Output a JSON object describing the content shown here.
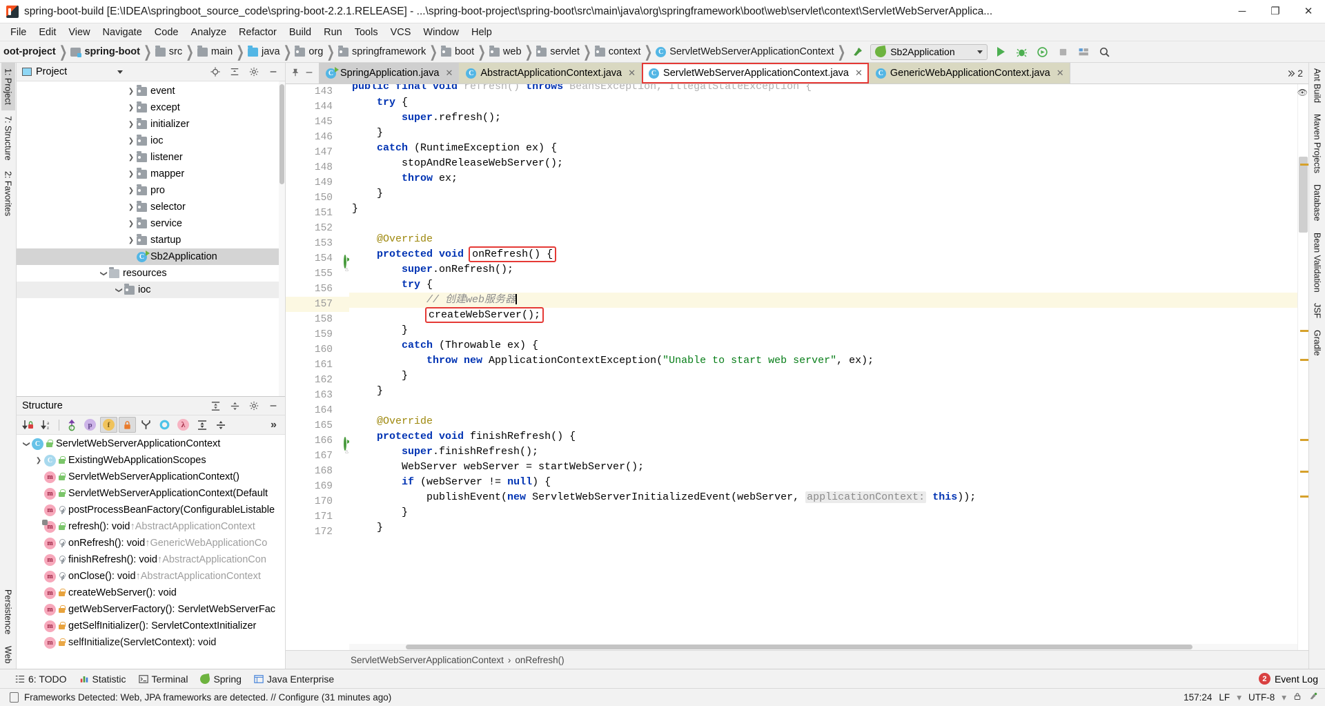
{
  "window": {
    "title": "spring-boot-build [E:\\IDEA\\springboot_source_code\\spring-boot-2.2.1.RELEASE] - ...\\spring-boot-project\\spring-boot\\src\\main\\java\\org\\springframework\\boot\\web\\servlet\\context\\ServletWebServerApplica...",
    "minimize": "─",
    "maximize": "❐",
    "close": "✕"
  },
  "menubar": [
    "File",
    "Edit",
    "View",
    "Navigate",
    "Code",
    "Analyze",
    "Refactor",
    "Build",
    "Run",
    "Tools",
    "VCS",
    "Window",
    "Help"
  ],
  "navbar": {
    "crumbs": [
      {
        "label": "oot-project",
        "icon": "none",
        "bold": true
      },
      {
        "label": "spring-boot",
        "icon": "module",
        "bold": true
      },
      {
        "label": "src",
        "icon": "folder-src",
        "bold": false
      },
      {
        "label": "main",
        "icon": "folder",
        "bold": false
      },
      {
        "label": "java",
        "icon": "folder-blue",
        "bold": false
      },
      {
        "label": "org",
        "icon": "folder-pkg",
        "bold": false
      },
      {
        "label": "springframework",
        "icon": "folder-pkg",
        "bold": false
      },
      {
        "label": "boot",
        "icon": "folder-pkg",
        "bold": false
      },
      {
        "label": "web",
        "icon": "folder-pkg",
        "bold": false
      },
      {
        "label": "servlet",
        "icon": "folder-pkg",
        "bold": false
      },
      {
        "label": "context",
        "icon": "folder-pkg",
        "bold": false
      },
      {
        "label": "ServletWebServerApplicationContext",
        "icon": "class",
        "bold": false
      }
    ],
    "separator": "❯",
    "run_config": "Sb2Application",
    "buttons": [
      "make-project-icon",
      "run-icon",
      "debug-icon",
      "run-with-coverage-icon",
      "stop-icon",
      "search-everywhere-icon",
      "settings-icon"
    ]
  },
  "project_panel": {
    "title": "Project",
    "header_icons": [
      "locate-icon",
      "collapse-all-icon",
      "settings-icon",
      "hide-icon"
    ],
    "items": [
      {
        "label": "event",
        "indent": 5,
        "arrow": "right",
        "icon": "folder-pkg",
        "selected": false
      },
      {
        "label": "except",
        "indent": 5,
        "arrow": "right",
        "icon": "folder-pkg",
        "selected": false
      },
      {
        "label": "initializer",
        "indent": 5,
        "arrow": "right",
        "icon": "folder-pkg",
        "selected": false
      },
      {
        "label": "ioc",
        "indent": 5,
        "arrow": "right",
        "icon": "folder-pkg",
        "selected": false
      },
      {
        "label": "listener",
        "indent": 5,
        "arrow": "right",
        "icon": "folder-pkg",
        "selected": false
      },
      {
        "label": "mapper",
        "indent": 5,
        "arrow": "right",
        "icon": "folder-pkg",
        "selected": false
      },
      {
        "label": "pro",
        "indent": 5,
        "arrow": "right",
        "icon": "folder-pkg",
        "selected": false
      },
      {
        "label": "selector",
        "indent": 5,
        "arrow": "right",
        "icon": "folder-pkg",
        "selected": false
      },
      {
        "label": "service",
        "indent": 5,
        "arrow": "right",
        "icon": "folder-pkg",
        "selected": false
      },
      {
        "label": "startup",
        "indent": 5,
        "arrow": "right",
        "icon": "folder-pkg",
        "selected": false
      },
      {
        "label": "Sb2Application",
        "indent": 6,
        "arrow": "none",
        "icon": "spring-class",
        "selected": true
      },
      {
        "label": "resources",
        "indent": 4,
        "arrow": "down",
        "icon": "folder-resources",
        "selected": false
      },
      {
        "label": "ioc",
        "indent": 5,
        "arrow": "down",
        "icon": "folder-pkg",
        "selected": false
      }
    ]
  },
  "structure_panel": {
    "title": "Structure",
    "header_icons": [
      "expand-all-icon",
      "collapse-all-icon",
      "settings-icon",
      "hide-icon"
    ],
    "toolbar_icons": [
      {
        "name": "sort-by-visibility-icon",
        "pressed": false
      },
      {
        "name": "sort-alphabetically-icon",
        "pressed": false
      },
      {
        "name": "show-inherited-icon",
        "pressed": false
      },
      {
        "name": "show-properties-icon",
        "pressed": false
      },
      {
        "name": "show-fields-icon",
        "pressed": true
      },
      {
        "name": "show-non-public-icon",
        "pressed": true
      },
      {
        "name": "group-by-icon",
        "pressed": false
      },
      {
        "name": "show-interfaces-icon",
        "pressed": false
      },
      {
        "name": "show-lambdas-icon",
        "pressed": false
      },
      {
        "name": "expand-all-icon",
        "pressed": false
      },
      {
        "name": "collapse-all-icon",
        "pressed": false
      },
      {
        "name": "more-icon",
        "pressed": false
      }
    ],
    "items": [
      {
        "label": "ServletWebServerApplicationContext",
        "inherit": "",
        "indent": 0,
        "arrow": "down",
        "kind": "class",
        "vis": "green"
      },
      {
        "label": "ExistingWebApplicationScopes",
        "inherit": "",
        "indent": 1,
        "arrow": "right",
        "kind": "class-static",
        "vis": "green"
      },
      {
        "label": "ServletWebServerApplicationContext()",
        "inherit": "",
        "indent": 2,
        "arrow": "none",
        "kind": "method",
        "vis": "green"
      },
      {
        "label": "ServletWebServerApplicationContext(Default",
        "inherit": "",
        "indent": 2,
        "arrow": "none",
        "kind": "method",
        "vis": "green"
      },
      {
        "label": "postProcessBeanFactory(ConfigurableListable",
        "inherit": "",
        "indent": 2,
        "arrow": "none",
        "kind": "method",
        "vis": "key"
      },
      {
        "label": "refresh(): void ",
        "inherit": "↑AbstractApplicationContext",
        "indent": 2,
        "arrow": "none",
        "kind": "method-override",
        "vis": "green"
      },
      {
        "label": "onRefresh(): void ",
        "inherit": "↑GenericWebApplicationCo",
        "indent": 2,
        "arrow": "none",
        "kind": "method",
        "vis": "key"
      },
      {
        "label": "finishRefresh(): void ",
        "inherit": "↑AbstractApplicationCon",
        "indent": 2,
        "arrow": "none",
        "kind": "method",
        "vis": "key"
      },
      {
        "label": "onClose(): void ",
        "inherit": "↑AbstractApplicationContext",
        "indent": 2,
        "arrow": "none",
        "kind": "method",
        "vis": "key"
      },
      {
        "label": "createWebServer(): void",
        "inherit": "",
        "indent": 2,
        "arrow": "none",
        "kind": "method",
        "vis": "orange"
      },
      {
        "label": "getWebServerFactory(): ServletWebServerFac",
        "inherit": "",
        "indent": 2,
        "arrow": "none",
        "kind": "method",
        "vis": "orange"
      },
      {
        "label": "getSelfInitializer(): ServletContextInitializer",
        "inherit": "",
        "indent": 2,
        "arrow": "none",
        "kind": "method",
        "vis": "orange"
      },
      {
        "label": "selfInitialize(ServletContext): void",
        "inherit": "",
        "indent": 2,
        "arrow": "none",
        "kind": "method",
        "vis": "orange"
      }
    ]
  },
  "left_rail": [
    {
      "label": "1: Project",
      "active": true
    },
    {
      "label": "7: Structure",
      "active": false
    },
    {
      "label": "2: Favorites",
      "active": false
    },
    {
      "label": "Persistence",
      "active": false
    },
    {
      "label": "Web",
      "active": false
    }
  ],
  "right_rail": [
    {
      "label": "Ant Build"
    },
    {
      "label": "Maven Projects"
    },
    {
      "label": "Database"
    },
    {
      "label": "Bean Validation"
    },
    {
      "label": "JSF"
    },
    {
      "label": "Gradle"
    }
  ],
  "editor": {
    "tabs": [
      {
        "label": "SpringApplication.java",
        "style": "t-gray",
        "active": false,
        "highlighted": false,
        "icon": "spring-class-icon"
      },
      {
        "label": "AbstractApplicationContext.java",
        "style": "t-olive",
        "active": false,
        "highlighted": false,
        "icon": "class-icon"
      },
      {
        "label": "ServletWebServerApplicationContext.java",
        "style": "t-active",
        "active": true,
        "highlighted": true,
        "icon": "class-icon"
      },
      {
        "label": "GenericWebApplicationContext.java",
        "style": "t-olive",
        "active": false,
        "highlighted": false,
        "icon": "class-icon"
      }
    ],
    "tab_close": "✕",
    "tabs_count": "2",
    "first_line_number": 143,
    "lines": [
      {
        "n": 143,
        "text": "public final void refresh() throws BeansException, IllegalStateException {",
        "partial_top": true
      },
      {
        "n": 144,
        "text": "    try {"
      },
      {
        "n": 145,
        "text": "        super.refresh();"
      },
      {
        "n": 146,
        "text": "    }"
      },
      {
        "n": 147,
        "text": "    catch (RuntimeException ex) {"
      },
      {
        "n": 148,
        "text": "        stopAndReleaseWebServer();"
      },
      {
        "n": 149,
        "text": "        throw ex;"
      },
      {
        "n": 150,
        "text": "    }"
      },
      {
        "n": 151,
        "text": "}"
      },
      {
        "n": 152,
        "text": ""
      },
      {
        "n": 153,
        "text": "@Override"
      },
      {
        "n": 154,
        "text": "protected void onRefresh() {"
      },
      {
        "n": 155,
        "text": "    super.onRefresh();"
      },
      {
        "n": 156,
        "text": "    try {"
      },
      {
        "n": 157,
        "text": "        // 创建web服务器"
      },
      {
        "n": 158,
        "text": "        createWebServer();"
      },
      {
        "n": 159,
        "text": "    }"
      },
      {
        "n": 160,
        "text": "    catch (Throwable ex) {"
      },
      {
        "n": 161,
        "text": "        throw new ApplicationContextException(\"Unable to start web server\", ex);"
      },
      {
        "n": 162,
        "text": "    }"
      },
      {
        "n": 163,
        "text": "}"
      },
      {
        "n": 164,
        "text": ""
      },
      {
        "n": 165,
        "text": "@Override"
      },
      {
        "n": 166,
        "text": "protected void finishRefresh() {"
      },
      {
        "n": 167,
        "text": "    super.finishRefresh();"
      },
      {
        "n": 168,
        "text": "    WebServer webServer = startWebServer();"
      },
      {
        "n": 169,
        "text": "    if (webServer != null) {"
      },
      {
        "n": 170,
        "text": "        publishEvent(new ServletWebServerInitializedEvent(webServer,  applicationContext: this));"
      },
      {
        "n": 171,
        "text": "    }"
      },
      {
        "n": 172,
        "text": "}"
      }
    ],
    "highlighted_line": 157,
    "comment_text": "// 创建web服务器",
    "string_literal": "\"Unable to start web server\"",
    "param_hint": "applicationContext:",
    "breadcrumb": [
      "ServletWebServerApplicationContext",
      "onRefresh()"
    ],
    "breadcrumb_sep": "›",
    "red_boxes": [
      "onRefresh() {",
      "createWebServer();",
      "ServletWebServerApplicationContext.java"
    ]
  },
  "bottom_bar": {
    "items": [
      {
        "label": "6: TODO",
        "icon": "todo-icon"
      },
      {
        "label": "Statistic",
        "icon": "statistic-icon"
      },
      {
        "label": "Terminal",
        "icon": "terminal-icon"
      },
      {
        "label": "Spring",
        "icon": "spring-icon"
      },
      {
        "label": "Java Enterprise",
        "icon": "java-enterprise-icon"
      }
    ],
    "event_log": {
      "label": "Event Log",
      "count": "2"
    }
  },
  "status_bar": {
    "message": "Frameworks Detected: Web, JPA frameworks are detected. // Configure (31 minutes ago)",
    "position": "157:24",
    "line_sep": "LF",
    "encoding": "UTF-8",
    "chevron": "▾"
  },
  "colors": {
    "accent_red": "#e53935",
    "highlight_line": "#fcf8e2",
    "keyword_blue": "#0033b3",
    "string_green": "#067d17",
    "comment_gray": "#8c8c8c",
    "selection_gray": "#d4d4d4"
  }
}
